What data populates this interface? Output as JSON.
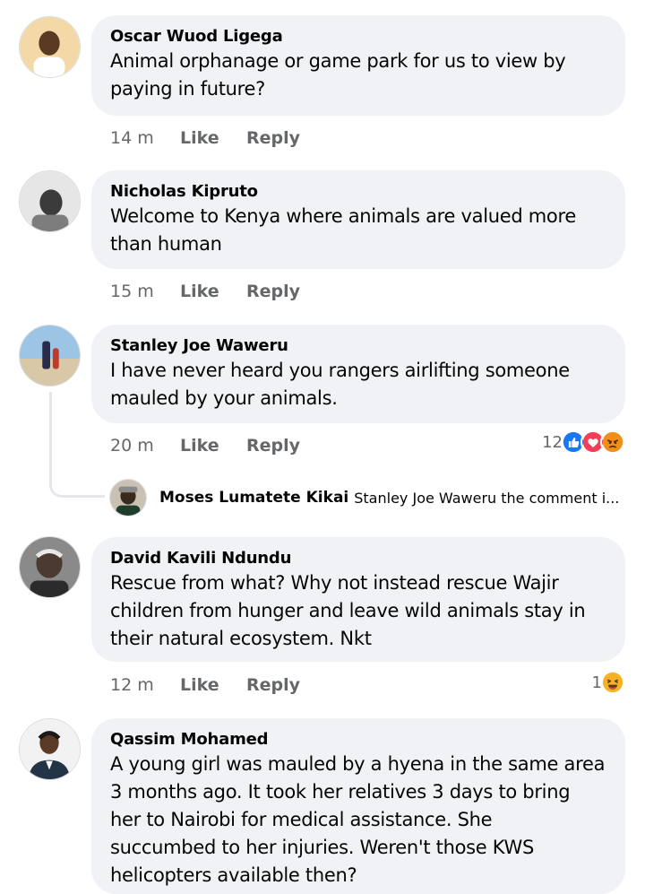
{
  "actions": {
    "like_label": "Like",
    "reply_label": "Reply"
  },
  "comments": [
    {
      "author": "Oscar Wuod Ligega",
      "lines": [
        "Animal orphanage or game park for us to view by",
        "paying in future?"
      ],
      "time": "14 m"
    },
    {
      "author": "Nicholas Kipruto",
      "lines": [
        "Welcome to Kenya where animals are valued more",
        "than human"
      ],
      "time": "15 m"
    },
    {
      "author": "Stanley Joe Waweru",
      "lines": [
        "I have never heard you rangers airlifting someone",
        "mauled by your animals."
      ],
      "time": "20 m",
      "reaction_count": "12",
      "reactions": [
        "like-reaction-icon",
        "love-reaction-icon",
        "angry-reaction-icon"
      ],
      "reply": {
        "author": "Moses Lumatete Kikai",
        "snippet": "Stanley Joe Waweru the comment i..."
      }
    },
    {
      "author": "David Kavili Ndundu",
      "lines": [
        "Rescue from what? Why not instead rescue Wajir",
        "children from hunger and leave wild animals stay in",
        "their natural ecosystem. Nkt"
      ],
      "time": "12 m",
      "reaction_count": "1",
      "reactions": [
        "haha-reaction-icon"
      ]
    },
    {
      "author": "Qassim Mohamed",
      "lines": [
        "A young girl was mauled by a hyena in the same area",
        "3 months ago. It took her relatives 3 days to bring",
        "her to Nairobi for medical assistance.  She",
        "succumbed to her injuries. Weren't those KWS",
        "helicopters available then?"
      ]
    }
  ],
  "colors": {
    "bubble": "#f0f2f5",
    "secondary_text": "#65676b",
    "like_blue": "#1877f2",
    "love_red": "#f33e58",
    "angry_orange": "#e9710f",
    "haha_yellow": "#f7b125"
  }
}
